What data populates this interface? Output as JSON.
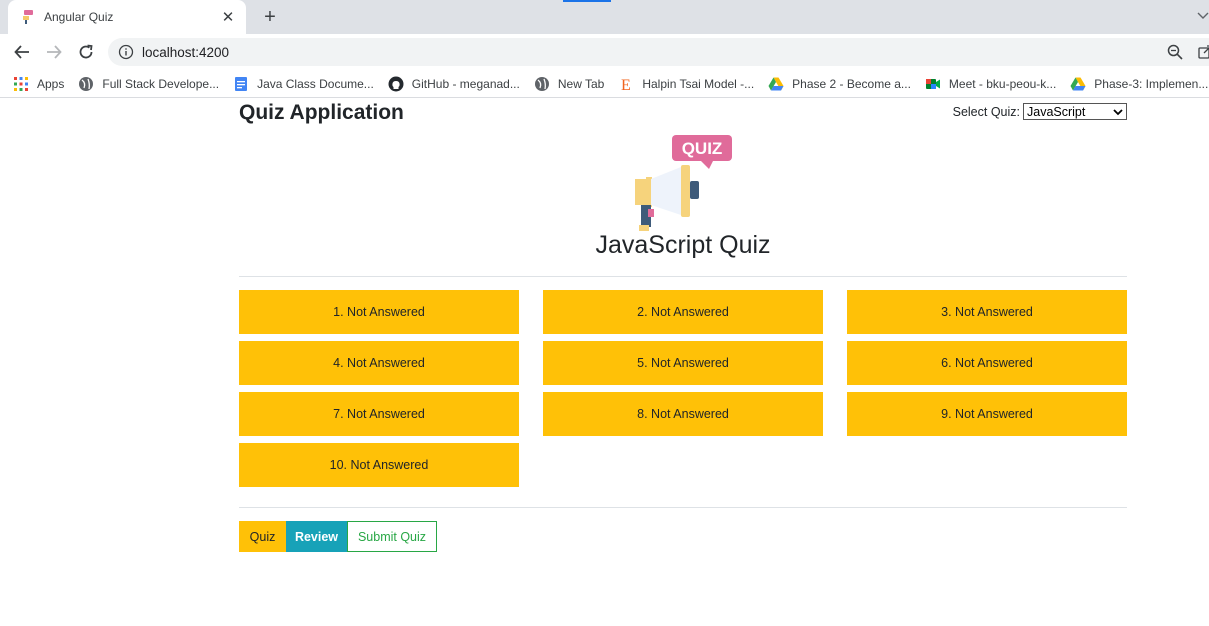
{
  "browser": {
    "tab": {
      "title": "Angular Quiz",
      "close_glyph": "✕"
    },
    "new_tab_glyph": "+",
    "address": "localhost:4200",
    "bookmarks": [
      {
        "label": "Apps",
        "icon": "apps-grid-icon"
      },
      {
        "label": "Full Stack Develope...",
        "icon": "globe-icon"
      },
      {
        "label": "Java Class Docume...",
        "icon": "doc-icon"
      },
      {
        "label": "GitHub - meganad...",
        "icon": "github-icon"
      },
      {
        "label": "New Tab",
        "icon": "globe-icon"
      },
      {
        "label": "Halpin Tsai Model -...",
        "icon": "etsy-e-icon"
      },
      {
        "label": "Phase 2 - Become a...",
        "icon": "drive-icon"
      },
      {
        "label": "Meet - bku-peou-k...",
        "icon": "meet-icon"
      },
      {
        "label": "Phase-3: Implemen...",
        "icon": "drive-icon"
      }
    ]
  },
  "app": {
    "title": "Quiz Application",
    "select_label": "Select Quiz:",
    "selected_quiz": "JavaScript",
    "logo_text": "QUIZ",
    "quiz_heading": "JavaScript Quiz",
    "questions": [
      "1. Not Answered",
      "2. Not Answered",
      "3. Not Answered",
      "4. Not Answered",
      "5. Not Answered",
      "6. Not Answered",
      "7. Not Answered",
      "8. Not Answered",
      "9. Not Answered",
      "10. Not Answered"
    ],
    "buttons": {
      "quiz": "Quiz",
      "review": "Review",
      "submit": "Submit Quiz"
    }
  },
  "colors": {
    "warning": "#ffc107",
    "info": "#17a2b8",
    "success": "#28a745",
    "logo_pink": "#e06b9a"
  }
}
